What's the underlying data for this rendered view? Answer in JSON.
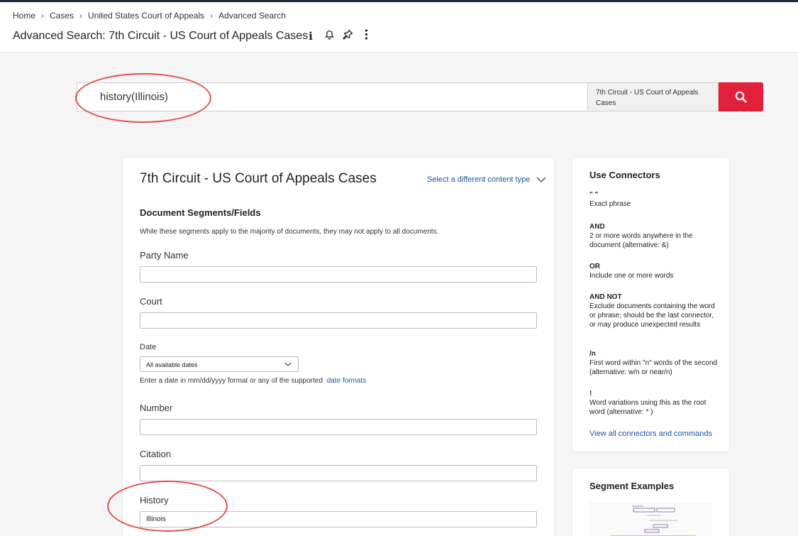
{
  "breadcrumb": [
    "Home",
    "Cases",
    "United States Court of Appeals",
    "Advanced Search"
  ],
  "page_title": "Advanced Search: 7th Circuit - US Court of Appeals Cases",
  "icons": {
    "info": "info-icon",
    "bell": "bell-icon",
    "pin": "pin-icon",
    "more": "more-vertical-icon",
    "search": "search-icon",
    "chevron": "chevron-down-icon"
  },
  "search": {
    "value": "history(Illinois)",
    "scope": "7th Circuit - US Court of Appeals Cases"
  },
  "form": {
    "title": "7th Circuit - US Court of Appeals Cases",
    "content_type_link": "Select a different content type",
    "section_title": "Document Segments/Fields",
    "section_note": "While these segments apply to the majority of documents, they may not apply to all documents.",
    "party_name_label": "Party Name",
    "party_name_value": "",
    "court_label": "Court",
    "court_value": "",
    "date_label": "Date",
    "date_selected": "All available dates",
    "date_help": "Enter a date in mm/dd/yyyy format or any of the supported",
    "date_formats_link": "date formats",
    "number_label": "Number",
    "number_value": "",
    "citation_label": "Citation",
    "citation_value": "",
    "history_label": "History",
    "history_value": "Illinois"
  },
  "connectors": {
    "title": "Use Connectors",
    "items": [
      {
        "name": "\" \"",
        "desc": "Exact phrase"
      },
      {
        "name": "AND",
        "desc": "2 or more words anywhere in the document (alternative: &)"
      },
      {
        "name": "OR",
        "desc": "Include one or more words"
      },
      {
        "name": "AND NOT",
        "desc": "Exclude documents containing the word or phrase; should be the last connector, or may produce unexpected results"
      },
      {
        "name": "/n",
        "desc": "First word within \"n\" words of the second (alternative: w/n or near/n)"
      },
      {
        "name": "!",
        "desc": "Word variations using this as the root word (alternative: * )"
      }
    ],
    "view_all_link": "View all connectors and commands"
  },
  "segment_examples": {
    "title": "Segment Examples"
  },
  "colors": {
    "accent_red": "#e3203c",
    "link_blue": "#1a58a6",
    "annotation": "#e05050"
  }
}
